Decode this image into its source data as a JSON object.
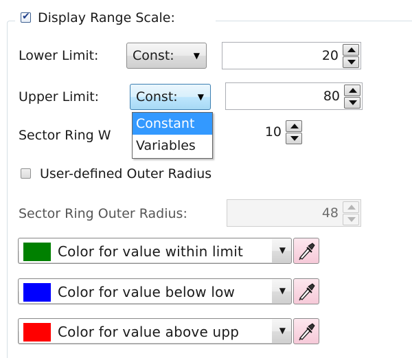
{
  "display_range_scale": {
    "label": "Display Range Scale:",
    "checked": true
  },
  "lower_limit": {
    "label": "Lower Limit:",
    "mode": "Const:",
    "value": "20"
  },
  "upper_limit": {
    "label": "Upper Limit:",
    "mode": "Const:",
    "value": "80",
    "dropdown_options": [
      "Constant",
      "Variables"
    ]
  },
  "sector_ring_width": {
    "label": "Sector Ring W",
    "value": "10"
  },
  "user_defined_outer_radius": {
    "label": "User-defined Outer Radius",
    "checked": false
  },
  "sector_ring_outer_radius": {
    "label": "Sector Ring Outer Radius:",
    "value": "48"
  },
  "colors": [
    {
      "label": "Color for value within limit",
      "swatch": "#008000",
      "icon": "eyedropper-icon"
    },
    {
      "label": "Color for value below low",
      "swatch": "#0000ff",
      "icon": "eyedropper-icon"
    },
    {
      "label": "Color for value above upp",
      "swatch": "#ff0000",
      "icon": "eyedropper-icon"
    }
  ]
}
